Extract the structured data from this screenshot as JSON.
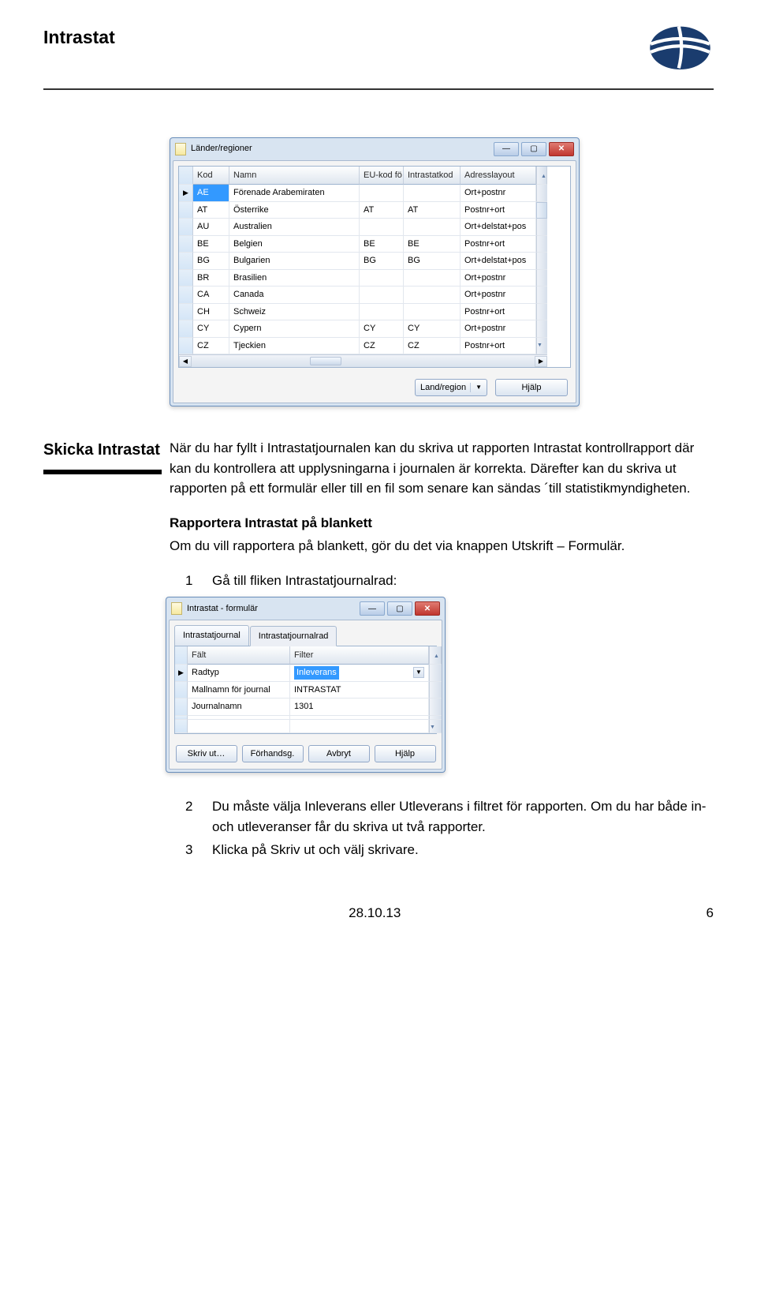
{
  "header": {
    "title": "Intrastat"
  },
  "win1": {
    "title": "Länder/regioner",
    "columns": [
      "Kod",
      "Namn",
      "EU-kod fö…",
      "Intrastatkod",
      "Adresslayout"
    ],
    "rows": [
      {
        "kod": "AE",
        "namn": "Förenade Arabemiraten",
        "eu": "",
        "intra": "",
        "addr": "Ort+postnr"
      },
      {
        "kod": "AT",
        "namn": "Österrike",
        "eu": "AT",
        "intra": "AT",
        "addr": "Postnr+ort"
      },
      {
        "kod": "AU",
        "namn": "Australien",
        "eu": "",
        "intra": "",
        "addr": "Ort+delstat+pos"
      },
      {
        "kod": "BE",
        "namn": "Belgien",
        "eu": "BE",
        "intra": "BE",
        "addr": "Postnr+ort"
      },
      {
        "kod": "BG",
        "namn": "Bulgarien",
        "eu": "BG",
        "intra": "BG",
        "addr": "Ort+delstat+pos"
      },
      {
        "kod": "BR",
        "namn": "Brasilien",
        "eu": "",
        "intra": "",
        "addr": "Ort+postnr"
      },
      {
        "kod": "CA",
        "namn": "Canada",
        "eu": "",
        "intra": "",
        "addr": "Ort+postnr"
      },
      {
        "kod": "CH",
        "namn": "Schweiz",
        "eu": "",
        "intra": "",
        "addr": "Postnr+ort"
      },
      {
        "kod": "CY",
        "namn": "Cypern",
        "eu": "CY",
        "intra": "CY",
        "addr": "Ort+postnr"
      },
      {
        "kod": "CZ",
        "namn": "Tjeckien",
        "eu": "CZ",
        "intra": "CZ",
        "addr": "Postnr+ort"
      }
    ],
    "footer_buttons": {
      "land": "Land/region",
      "help": "Hjälp"
    }
  },
  "section": {
    "side_label": "Skicka Intrastat",
    "p1": "När du har fyllt i Intrastatjournalen kan du skriva ut rapporten Intrastat kontrollrapport där kan du kontrollera att upplysningarna i journalen är korrekta. Därefter kan du skriva ut rapporten på ett formulär eller till en fil som senare kan sändas ´till statistikmyndigheten.",
    "sub_h": "Rapportera Intrastat på blankett",
    "p2": "Om du vill rapportera på blankett, gör du det via knappen Utskrift – Formulär.",
    "step1_num": "1",
    "step1": "Gå till fliken Intrastatjournalrad:"
  },
  "win2": {
    "title": "Intrastat - formulär",
    "tab1": "Intrastatjournal",
    "tab2": "Intrastatjournalrad",
    "col1": "Fält",
    "col2": "Filter",
    "rows": [
      {
        "f": "Radtyp",
        "v": "Inleverans",
        "hl": true
      },
      {
        "f": "Mallnamn för journal",
        "v": "INTRASTAT"
      },
      {
        "f": "Journalnamn",
        "v": "1301"
      }
    ],
    "buttons": {
      "print": "Skriv ut…",
      "preview": "Förhandsg.",
      "cancel": "Avbryt",
      "help": "Hjälp"
    }
  },
  "steps_after": {
    "n2": "2",
    "t2": "Du måste välja Inleverans eller Utleverans i filtret för rapporten. Om du har både in- och utleveranser får du skriva ut två rapporter.",
    "n3": "3",
    "t3": "Klicka på Skriv ut och välj skrivare."
  },
  "footer": {
    "date": "28.10.13",
    "page": "6"
  }
}
